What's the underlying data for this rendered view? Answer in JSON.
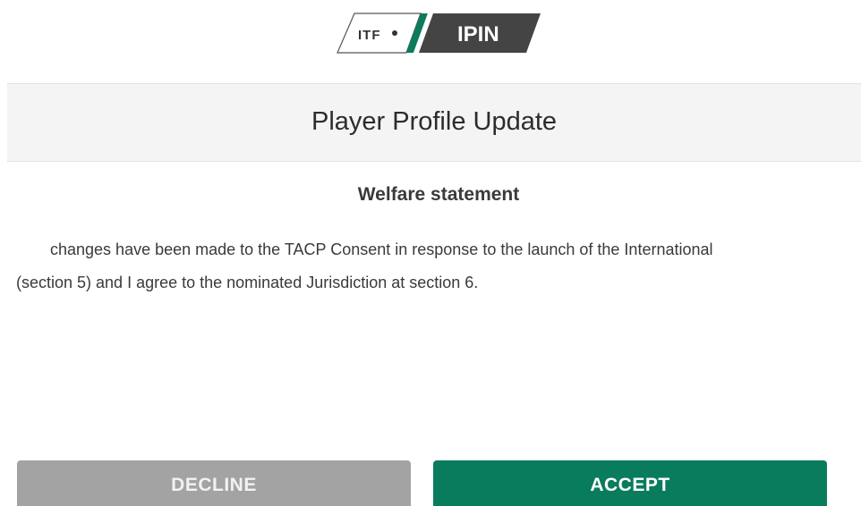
{
  "logo": {
    "left_text": "ITF",
    "right_text": "IPIN",
    "accent_green": "#0a7c5e",
    "dark_block": "#444444"
  },
  "header": {
    "title": "Player Profile Update"
  },
  "content": {
    "heading": "Welfare statement",
    "statement_line_1": "changes have been made to the TACP Consent in response to the launch of the International",
    "statement_line_2": "(section 5) and I agree to the nominated Jurisdiction at section 6."
  },
  "actions": {
    "decline_label": "DECLINE",
    "accept_label": "ACCEPT",
    "decline_color": "#a3a3a3",
    "accept_color": "#0a7c5e"
  }
}
